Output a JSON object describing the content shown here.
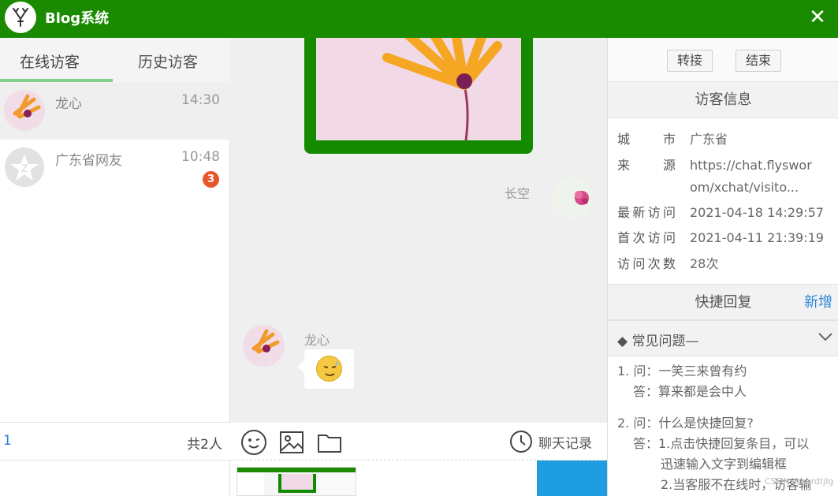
{
  "app": {
    "title": "Blog系统",
    "close_glyph": "✕"
  },
  "left": {
    "tabs": [
      {
        "label": "在线访客"
      },
      {
        "label": "历史访客"
      }
    ],
    "visitors": [
      {
        "name": "龙心",
        "time": "14:30",
        "badge": ""
      },
      {
        "name": "广东省网友",
        "time": "10:48",
        "badge": "3"
      }
    ],
    "footer": {
      "count": "1",
      "total": "共2人"
    }
  },
  "chat": {
    "me_name": "长空",
    "them_name": "龙心",
    "emoji_icon": "sweat-smile-emoji-icon",
    "toolbar": {
      "history_label": "聊天记录"
    }
  },
  "right": {
    "actions": {
      "transfer": "转接",
      "end": "结束"
    },
    "visitor_info_title": "访客信息",
    "info": [
      {
        "label": "城市",
        "value": "广东省"
      },
      {
        "label": "来源",
        "value": "https://chat.flyswor"
      },
      {
        "label": "",
        "value": "om/xchat/visito..."
      },
      {
        "label": "最新访问",
        "value": "2021-04-18 14:29:57"
      },
      {
        "label": "首次访问",
        "value": "2021-04-11 21:39:19"
      },
      {
        "label": "访问次数",
        "value": "28次"
      }
    ],
    "quick_reply_title": "快捷回复",
    "add_label": "新增",
    "faq": {
      "title": "◆ 常见问题—",
      "lines": [
        "1. 问：一笑三来曾有约",
        "答：算来都是会中人",
        "2. 问：什么是快捷回复?",
        "答：1.点击快捷回复条目，可以",
        "迅速输入文字到编辑框",
        "2.当客服不在线时，访客输"
      ]
    }
  },
  "watermark": "CSDN @sgrdtjlg",
  "colors": {
    "brand_green": "#1a8a00",
    "badge": "#e8572a",
    "link": "#2f88d8",
    "send": "#1e9ee0"
  }
}
